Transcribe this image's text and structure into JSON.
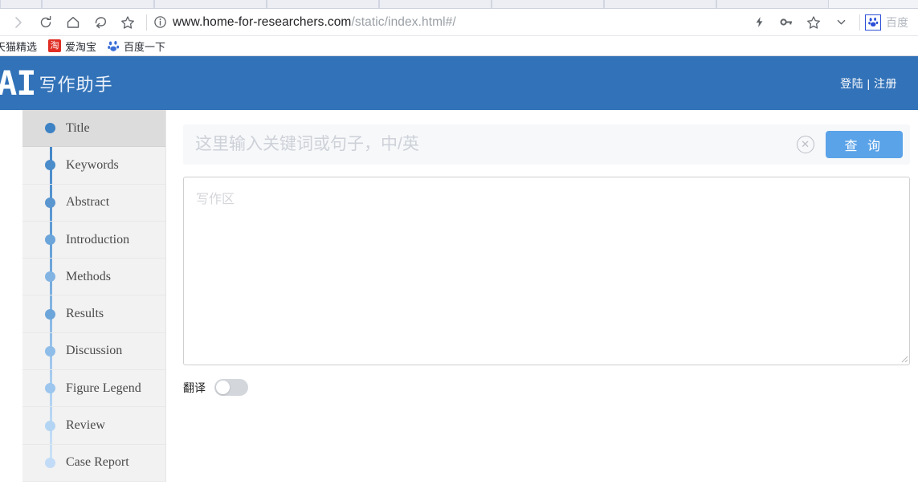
{
  "browser": {
    "toolbar_icons": [
      "forward-icon",
      "reload-icon",
      "home-icon",
      "back-icon",
      "bookmark-star-icon"
    ],
    "url": {
      "domain": "www.home-for-researchers.com",
      "path": "/static/index.html#/"
    },
    "right_icons": [
      "lightning-icon",
      "key-icon",
      "star-icon",
      "chevron-down-icon"
    ],
    "extension_label": "百度",
    "bookmarks": [
      {
        "label": "天猫精选",
        "icon": "tmall-icon"
      },
      {
        "label": "爱淘宝",
        "icon": "taobao-icon"
      },
      {
        "label": "百度一下",
        "icon": "baidu-paw-icon"
      }
    ]
  },
  "header": {
    "logo_ai": "AI",
    "logo_cn": "写作助手",
    "auth": "登陆 | 注册"
  },
  "sidebar": {
    "items": [
      {
        "label": "Title",
        "dot_color": "#3d82c4",
        "active": true
      },
      {
        "label": "Keywords",
        "dot_color": "#4b8cca",
        "active": false
      },
      {
        "label": "Abstract",
        "dot_color": "#5a96d0",
        "active": false
      },
      {
        "label": "Introduction",
        "dot_color": "#6ca5da",
        "active": false
      },
      {
        "label": "Methods",
        "dot_color": "#82b4e3",
        "active": false
      },
      {
        "label": "Results",
        "dot_color": "#6ca5da",
        "active": false
      },
      {
        "label": "Discussion",
        "dot_color": "#8fbde9",
        "active": false
      },
      {
        "label": "Figure Legend",
        "dot_color": "#9cc6ee",
        "active": false
      },
      {
        "label": "Review",
        "dot_color": "#b4d4f3",
        "active": false
      },
      {
        "label": "Case Report",
        "dot_color": "#c2dcf7",
        "active": false
      }
    ]
  },
  "main": {
    "search": {
      "value": "",
      "placeholder": "这里输入关键词或句子，中/英",
      "clear_icon": "clear-circle-icon",
      "button_label": "查 询"
    },
    "editor": {
      "value": "",
      "placeholder": "写作区"
    },
    "translate": {
      "label": "翻译",
      "enabled": false
    }
  },
  "colors": {
    "header_blue": "#3272b8",
    "button_blue": "#5ba3e8",
    "sidebar_bg": "#f2f2f2",
    "active_row": "#dcdcdc"
  }
}
